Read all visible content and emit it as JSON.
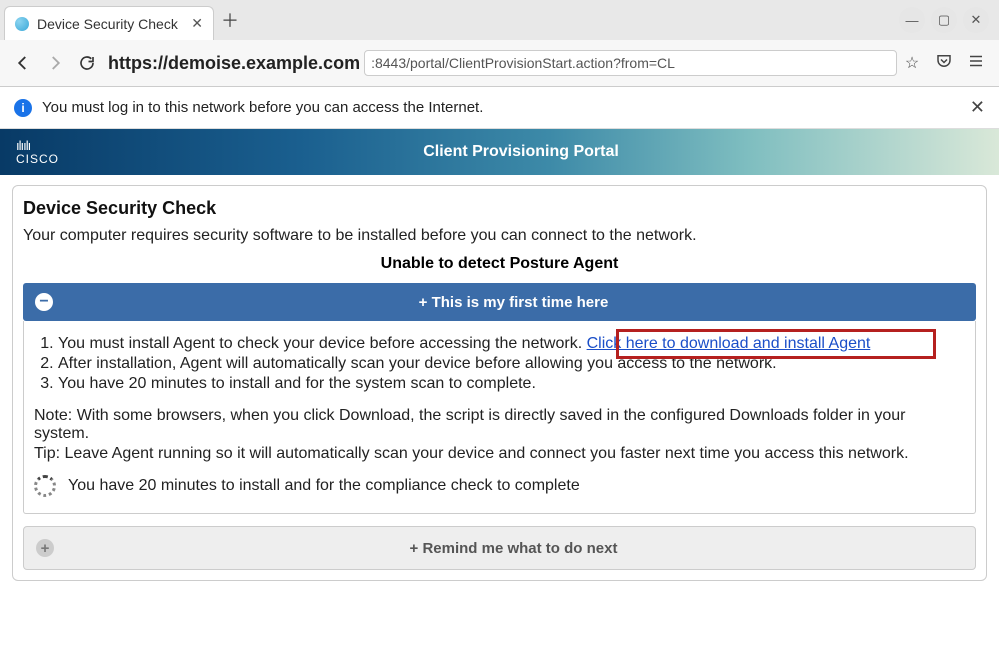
{
  "browser": {
    "tab_title": "Device Security Check",
    "url_host": "https://demoise.example.com",
    "url_path": ":8443/portal/ClientProvisionStart.action?from=CL"
  },
  "infobar": {
    "message": "You must log in to this network before you can access the Internet."
  },
  "portal": {
    "brand_bars": "ılıılı",
    "brand_text": "CISCO",
    "title": "Client Provisioning Portal"
  },
  "page": {
    "heading": "Device Security Check",
    "subtitle": "Your computer requires security software to be installed before you can connect to the network.",
    "status": "Unable to detect Posture Agent",
    "acc1_label": "+ This is my first time here",
    "steps": {
      "s1_pre": "You must install Agent to check your device before accessing the network. ",
      "s1_link": "Click here to download and install Agent",
      "s2": "After installation, Agent will automatically scan your device before allowing you access to the network.",
      "s3": "You have 20 minutes to install and for the system scan to complete."
    },
    "note": "Note: With some browsers, when you click Download, the script is directly saved in the configured Downloads folder in your system.",
    "tip": "Tip: Leave Agent running so it will automatically scan your device and connect you faster next time you access this network.",
    "progress_msg": "You have 20 minutes to install and for the compliance check to complete",
    "acc2_label": "+ Remind me what to do next"
  }
}
